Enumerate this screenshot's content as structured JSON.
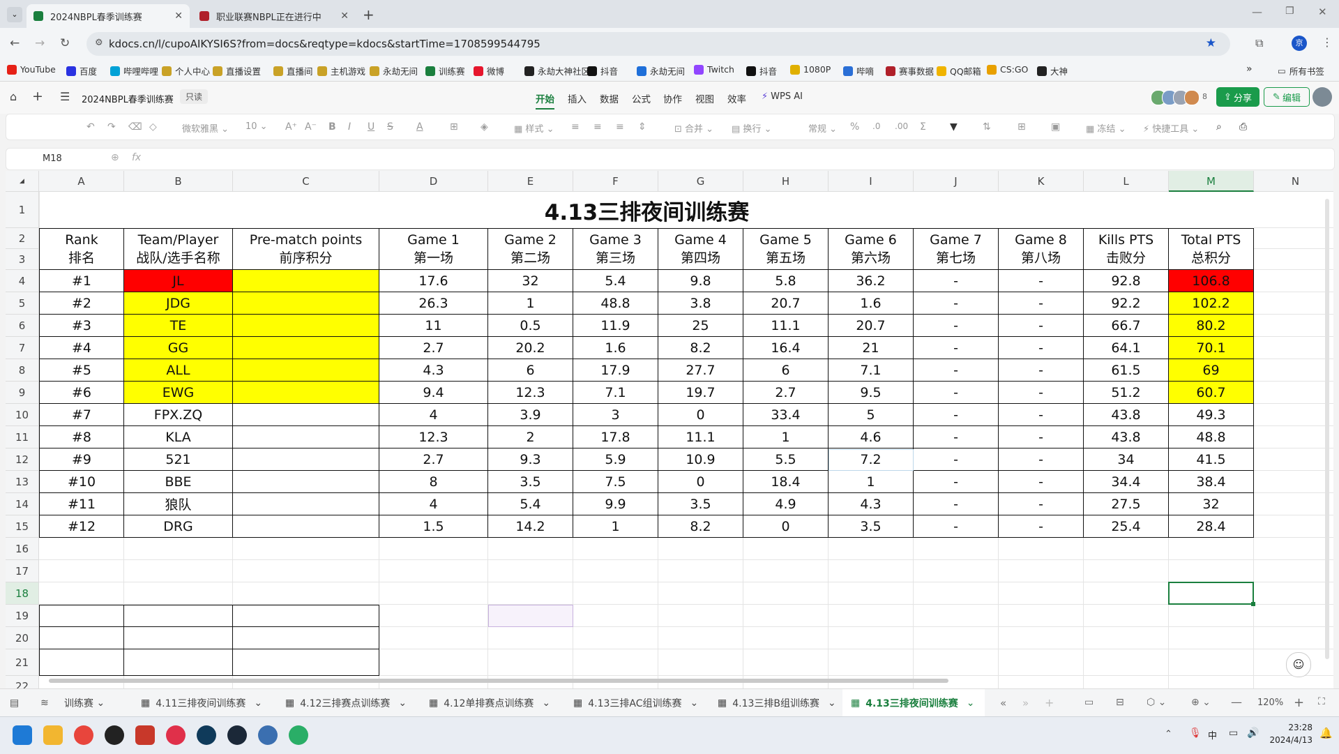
{
  "browser": {
    "tabs": [
      {
        "title": "2024NBPL春季训练赛",
        "active": true,
        "color": "#1a7f3e"
      },
      {
        "title": "职业联赛NBPL正在进行中",
        "active": false,
        "color": "#b0202a"
      }
    ],
    "url": "kdocs.cn/l/cupoAIKYSI6S?from=docs&reqtype=kdocs&startTime=1708599544795",
    "profile_initial": "京",
    "bookmarks": [
      {
        "label": "YouTube",
        "color": "#e62117"
      },
      {
        "label": "百度",
        "color": "#2932e1"
      },
      {
        "label": "哔哩哔哩",
        "color": "#00a1d6"
      },
      {
        "label": "个人中心",
        "color": "#c9a227"
      },
      {
        "label": "直播设置",
        "color": "#c9a227"
      },
      {
        "label": "直播间",
        "color": "#c9a227"
      },
      {
        "label": "主机游戏",
        "color": "#c9a227"
      },
      {
        "label": "永劫无间",
        "color": "#c9a227"
      },
      {
        "label": "训练赛",
        "color": "#1a7f3e"
      },
      {
        "label": "微博",
        "color": "#e6162d"
      },
      {
        "label": "永劫大神社区",
        "color": "#222222"
      },
      {
        "label": "抖音",
        "color": "#111111"
      },
      {
        "label": "永劫无间",
        "color": "#1e6fd9"
      },
      {
        "label": "Twitch",
        "color": "#9146ff"
      },
      {
        "label": "抖音",
        "color": "#111111"
      },
      {
        "label": "1080P",
        "color": "#e0b000"
      },
      {
        "label": "哔嘀",
        "color": "#2a6fd6"
      },
      {
        "label": "赛事数据",
        "color": "#b0202a"
      },
      {
        "label": "QQ邮箱",
        "color": "#f0b400"
      },
      {
        "label": "CS:GO",
        "color": "#e8a000"
      },
      {
        "label": "大神",
        "color": "#222222"
      }
    ],
    "all_bookmarks": "所有书签"
  },
  "wps": {
    "doc_title": "2024NBPL春季训练赛",
    "readonly_badge": "只读",
    "menus": [
      "开始",
      "插入",
      "数据",
      "公式",
      "协作",
      "视图",
      "效率"
    ],
    "wps_ai": "WPS AI",
    "collab_count": "8",
    "share": "分享",
    "edit": "编辑",
    "toolbar": {
      "font": "微软雅黑",
      "size": "10",
      "style": "样式",
      "merge": "合并",
      "wrap": "换行",
      "format": "常规",
      "freeze": "冻结",
      "quicktools": "快捷工具"
    },
    "cell_ref": "M18",
    "fx": "fx"
  },
  "sheet": {
    "columns": [
      "A",
      "B",
      "C",
      "D",
      "E",
      "F",
      "G",
      "H",
      "I",
      "J",
      "K",
      "L",
      "M",
      "N"
    ],
    "rows": [
      "1",
      "2",
      "3",
      "4",
      "5",
      "6",
      "7",
      "8",
      "9",
      "10",
      "11",
      "12",
      "13",
      "14",
      "15",
      "16",
      "17",
      "18",
      "19",
      "20",
      "21",
      "22"
    ],
    "title": "4.13三排夜间训练赛",
    "headers_en": [
      "Rank",
      "Team/Player",
      "Pre-match points",
      "Game 1",
      "Game 2",
      "Game 3",
      "Game 4",
      "Game 5",
      "Game 6",
      "Game 7",
      "Game 8",
      "Kills PTS",
      "Total PTS"
    ],
    "headers_cn": [
      "排名",
      "战队/选手名称",
      "前序积分",
      "第一场",
      "第二场",
      "第三场",
      "第四场",
      "第五场",
      "第六场",
      "第七场",
      "第八场",
      "击败分",
      "总积分"
    ],
    "data": [
      [
        "#1",
        "JL",
        "",
        "17.6",
        "32",
        "5.4",
        "9.8",
        "5.8",
        "36.2",
        "-",
        "-",
        "92.8",
        "106.8"
      ],
      [
        "#2",
        "JDG",
        "",
        "26.3",
        "1",
        "48.8",
        "3.8",
        "20.7",
        "1.6",
        "-",
        "-",
        "92.2",
        "102.2"
      ],
      [
        "#3",
        "TE",
        "",
        "11",
        "0.5",
        "11.9",
        "25",
        "11.1",
        "20.7",
        "-",
        "-",
        "66.7",
        "80.2"
      ],
      [
        "#4",
        "GG",
        "",
        "2.7",
        "20.2",
        "1.6",
        "8.2",
        "16.4",
        "21",
        "-",
        "-",
        "64.1",
        "70.1"
      ],
      [
        "#5",
        "ALL",
        "",
        "4.3",
        "6",
        "17.9",
        "27.7",
        "6",
        "7.1",
        "-",
        "-",
        "61.5",
        "69"
      ],
      [
        "#6",
        "EWG",
        "",
        "9.4",
        "12.3",
        "7.1",
        "19.7",
        "2.7",
        "9.5",
        "-",
        "-",
        "51.2",
        "60.7"
      ],
      [
        "#7",
        "FPX.ZQ",
        "",
        "4",
        "3.9",
        "3",
        "0",
        "33.4",
        "5",
        "-",
        "-",
        "43.8",
        "49.3"
      ],
      [
        "#8",
        "KLA",
        "",
        "12.3",
        "2",
        "17.8",
        "11.1",
        "1",
        "4.6",
        "-",
        "-",
        "43.8",
        "48.8"
      ],
      [
        "#9",
        "521",
        "",
        "2.7",
        "9.3",
        "5.9",
        "10.9",
        "5.5",
        "7.2",
        "-",
        "-",
        "34",
        "41.5"
      ],
      [
        "#10",
        "BBE",
        "",
        "8",
        "3.5",
        "7.5",
        "0",
        "18.4",
        "1",
        "-",
        "-",
        "34.4",
        "38.4"
      ],
      [
        "#11",
        "狼队",
        "",
        "4",
        "5.4",
        "9.9",
        "3.5",
        "4.9",
        "4.3",
        "-",
        "-",
        "27.5",
        "32"
      ],
      [
        "#12",
        "DRG",
        "",
        "1.5",
        "14.2",
        "1",
        "8.2",
        "0",
        "3.5",
        "-",
        "-",
        "25.4",
        "28.4"
      ]
    ],
    "highlight_red": "#ff0000",
    "highlight_yellow": "#ffff00"
  },
  "sheet_tabs": {
    "list_label": "训练赛",
    "tabs": [
      "4.11三排夜间训练赛",
      "4.12三排赛点训练赛",
      "4.12单排赛点训练赛",
      "4.13三排AC组训练赛",
      "4.13三排B组训练赛",
      "4.13三排夜间训练赛"
    ],
    "active": "4.13三排夜间训练赛",
    "zoom": "120%"
  },
  "taskbar": {
    "time": "23:28",
    "date": "2024/4/13",
    "ime": "中"
  }
}
